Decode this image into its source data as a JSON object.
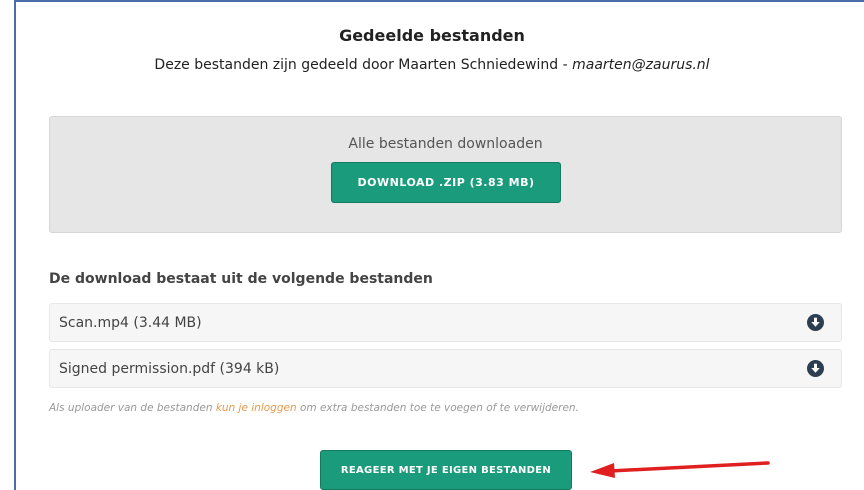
{
  "header": {
    "title": "Gedeelde bestanden",
    "shared_by_prefix": "Deze bestanden zijn gedeeld door Maarten Schniedewind - ",
    "shared_by_email": "maarten@zaurus.nl"
  },
  "download_all": {
    "label": "Alle bestanden downloaden",
    "button_label": "DOWNLOAD .ZIP (3.83 MB)"
  },
  "files": {
    "heading": "De download bestaat uit de volgende bestanden",
    "items": [
      {
        "name": "Scan.mp4 (3.44 MB)",
        "icon": "download-circle-icon"
      },
      {
        "name": "Signed permission.pdf (394 kB)",
        "icon": "download-circle-icon"
      }
    ]
  },
  "note": {
    "prefix": "Als uploader van de bestanden ",
    "link": "kun je inloggen",
    "suffix": " om extra bestanden toe te voegen of te verwijderen."
  },
  "reply_button_label": "REAGEER MET JE EIGEN BESTANDEN",
  "colors": {
    "accent": "#1a9b7c",
    "link": "#e59a4e",
    "icon": "#2c3e50",
    "annotation_arrow": "#e02020",
    "frame": "#4a6ea9"
  }
}
